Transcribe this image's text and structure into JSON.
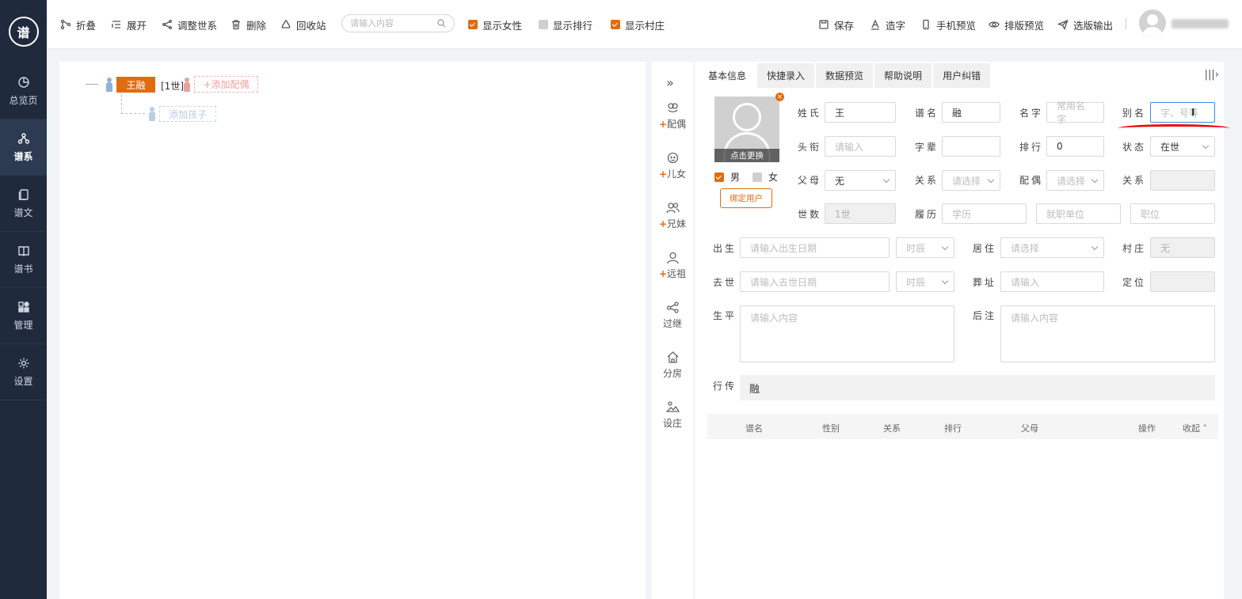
{
  "sidebar": {
    "logo_text": "谱",
    "items": [
      {
        "label": "总览页",
        "icon": "pie-icon",
        "active": false
      },
      {
        "label": "谱系",
        "icon": "tree-icon",
        "active": true
      },
      {
        "label": "谱文",
        "icon": "document-icon",
        "active": false
      },
      {
        "label": "谱书",
        "icon": "book-icon",
        "active": false
      },
      {
        "label": "管理",
        "icon": "grid-icon",
        "active": false
      },
      {
        "label": "设置",
        "icon": "gear-icon",
        "active": false
      }
    ]
  },
  "toolbar": {
    "fold": "折叠",
    "expand": "展开",
    "adjust": "调整世系",
    "delete": "删除",
    "recycle": "回收站",
    "search_placeholder": "请输入内容",
    "show_female": "显示女性",
    "show_rank": "显示排行",
    "show_village": "显示村庄",
    "save": "保存",
    "make_char": "造字",
    "mobile_preview": "手机预览",
    "layout_preview": "排版预览",
    "select_output": "选版输出"
  },
  "tree": {
    "root_name": "王融",
    "generation": "[1世]",
    "add_spouse": "+添加配偶",
    "add_child": "添加孩子"
  },
  "actions": {
    "spouse": "配偶",
    "children": "儿女",
    "siblings": "兄妹",
    "ancestor": "远祖",
    "adoption": "过继",
    "branch": "分房",
    "village": "设庄",
    "plus": "+"
  },
  "tabs": [
    "基本信息",
    "快捷录入",
    "数据预览",
    "帮助说明",
    "用户纠错"
  ],
  "form": {
    "photo_change": "点击更换",
    "male": "男",
    "female": "女",
    "bind_user": "绑定用户",
    "surname_label": "姓氏",
    "surname_value": "王",
    "puming_label": "谱名",
    "puming_value": "融",
    "name_label": "名字",
    "name_placeholder": "常用名字",
    "alias_label": "别名",
    "alias_placeholder": "字、号等",
    "title_label": "头衔",
    "title_placeholder": "请输入",
    "zibei_label": "字辈",
    "rank_label": "排行",
    "rank_value": "0",
    "status_label": "状态",
    "status_value": "在世",
    "parents_label": "父母",
    "parents_value": "无",
    "relation_label": "关系",
    "relation_placeholder": "请选择",
    "spouse_label": "配偶",
    "spouse_placeholder": "请选择",
    "relation2_label": "关系",
    "generation_label": "世数",
    "generation_value": "1世",
    "resume_label": "履历",
    "edu_placeholder": "学历",
    "work_placeholder": "就职单位",
    "post_placeholder": "职位",
    "birth_label": "出生",
    "birth_placeholder": "请输入出生日期",
    "shichen_placeholder": "时辰",
    "residence_label": "居住",
    "residence_placeholder": "请选择",
    "village_label": "村庄",
    "village_value": "无",
    "death_label": "去世",
    "death_placeholder": "请输入去世日期",
    "burial_label": "葬址",
    "burial_placeholder": "请输入",
    "locate_label": "定位",
    "life_label": "生平",
    "life_placeholder": "请输入内容",
    "postnote_label": "后注",
    "postnote_placeholder": "请输入内容",
    "xingzhuan_label": "行传",
    "xingzhuan_value": "融"
  },
  "table": {
    "headers": [
      "谱名",
      "性别",
      "关系",
      "排行",
      "父母",
      "操作",
      "收起"
    ]
  },
  "colors": {
    "accent": "#e06c12",
    "sidebar": "#1f2a3d"
  }
}
